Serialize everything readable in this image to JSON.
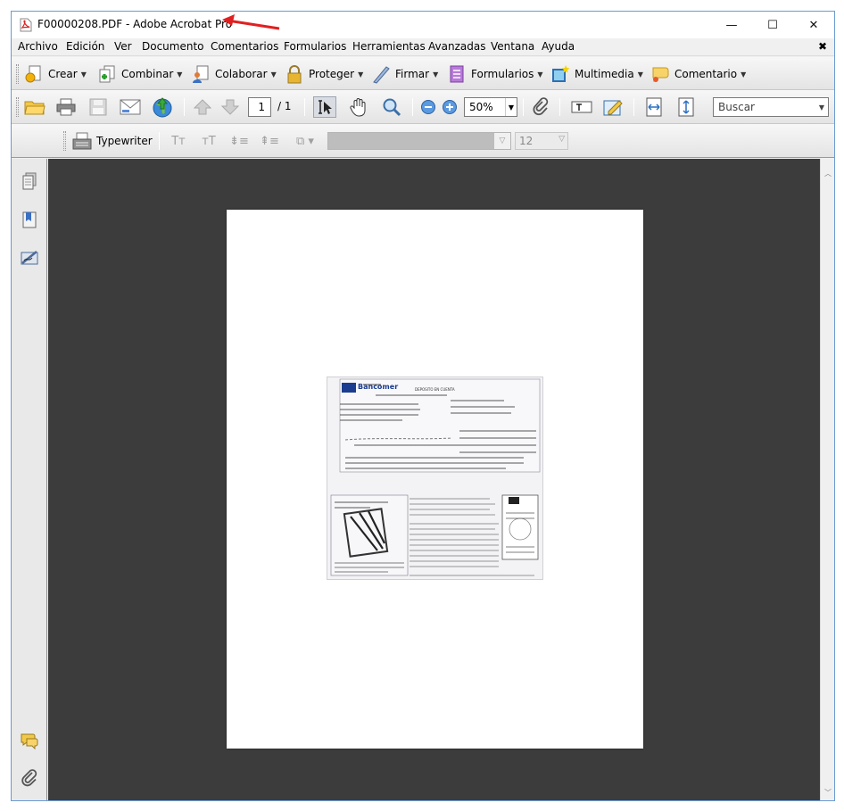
{
  "window": {
    "title": "F00000208.PDF - Adobe Acrobat Pro",
    "minimize_label": "—",
    "maximize_label": "☐",
    "close_label": "✕"
  },
  "menu": {
    "items": [
      "Archivo",
      "Edición",
      "Ver",
      "Documento",
      "Comentarios",
      "Formularios",
      "Herramientas",
      "Avanzadas",
      "Ventana",
      "Ayuda"
    ],
    "close_doc": "✖"
  },
  "tasks": {
    "crear": "Crear",
    "combinar": "Combinar",
    "colaborar": "Colaborar",
    "proteger": "Proteger",
    "firmar": "Firmar",
    "formularios": "Formularios",
    "multimedia": "Multimedia",
    "comentario": "Comentario"
  },
  "navigation": {
    "current_page": "1",
    "total_pages": "/ 1",
    "zoom": "50%",
    "search_placeholder": "Buscar"
  },
  "typewriter": {
    "label": "Typewriter",
    "font_size": "12"
  },
  "document": {
    "bank_name": "Bancomer",
    "receipt_title": "DEPOSITO EN CUENTA"
  },
  "colors": {
    "accent_arrow": "#e02020",
    "doc_background": "#3c3c3c",
    "bank_blue": "#1a3d8f"
  }
}
